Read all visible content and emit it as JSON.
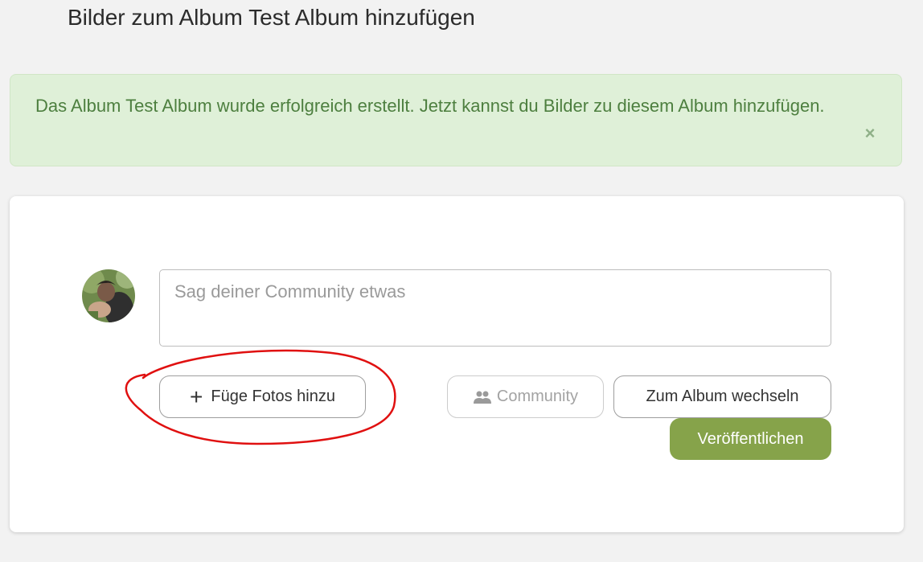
{
  "page": {
    "title": "Bilder zum Album Test Album hinzufügen"
  },
  "alert": {
    "message": "Das Album Test Album wurde erfolgreich erstellt. Jetzt kannst du Bilder zu diesem Album hinzufügen.",
    "close_icon": "close-icon",
    "close_glyph": "×"
  },
  "composer": {
    "avatar_icon": "user-avatar",
    "input_placeholder": "Sag deiner Community etwas",
    "input_value": "",
    "add_photos_label": "Füge Fotos hinzu",
    "add_photos_icon": "plus-icon",
    "plus_glyph": "+",
    "audience_label": "Community",
    "audience_icon": "people-icon",
    "switch_album_label": "Zum Album wechseln",
    "publish_label": "Veröffentlichen"
  },
  "colors": {
    "background": "#f2f2f2",
    "alert_bg": "#dff0d8",
    "alert_text": "#4d7f3f",
    "publish_bg": "#86a34a",
    "annotation_red": "#e01010"
  }
}
